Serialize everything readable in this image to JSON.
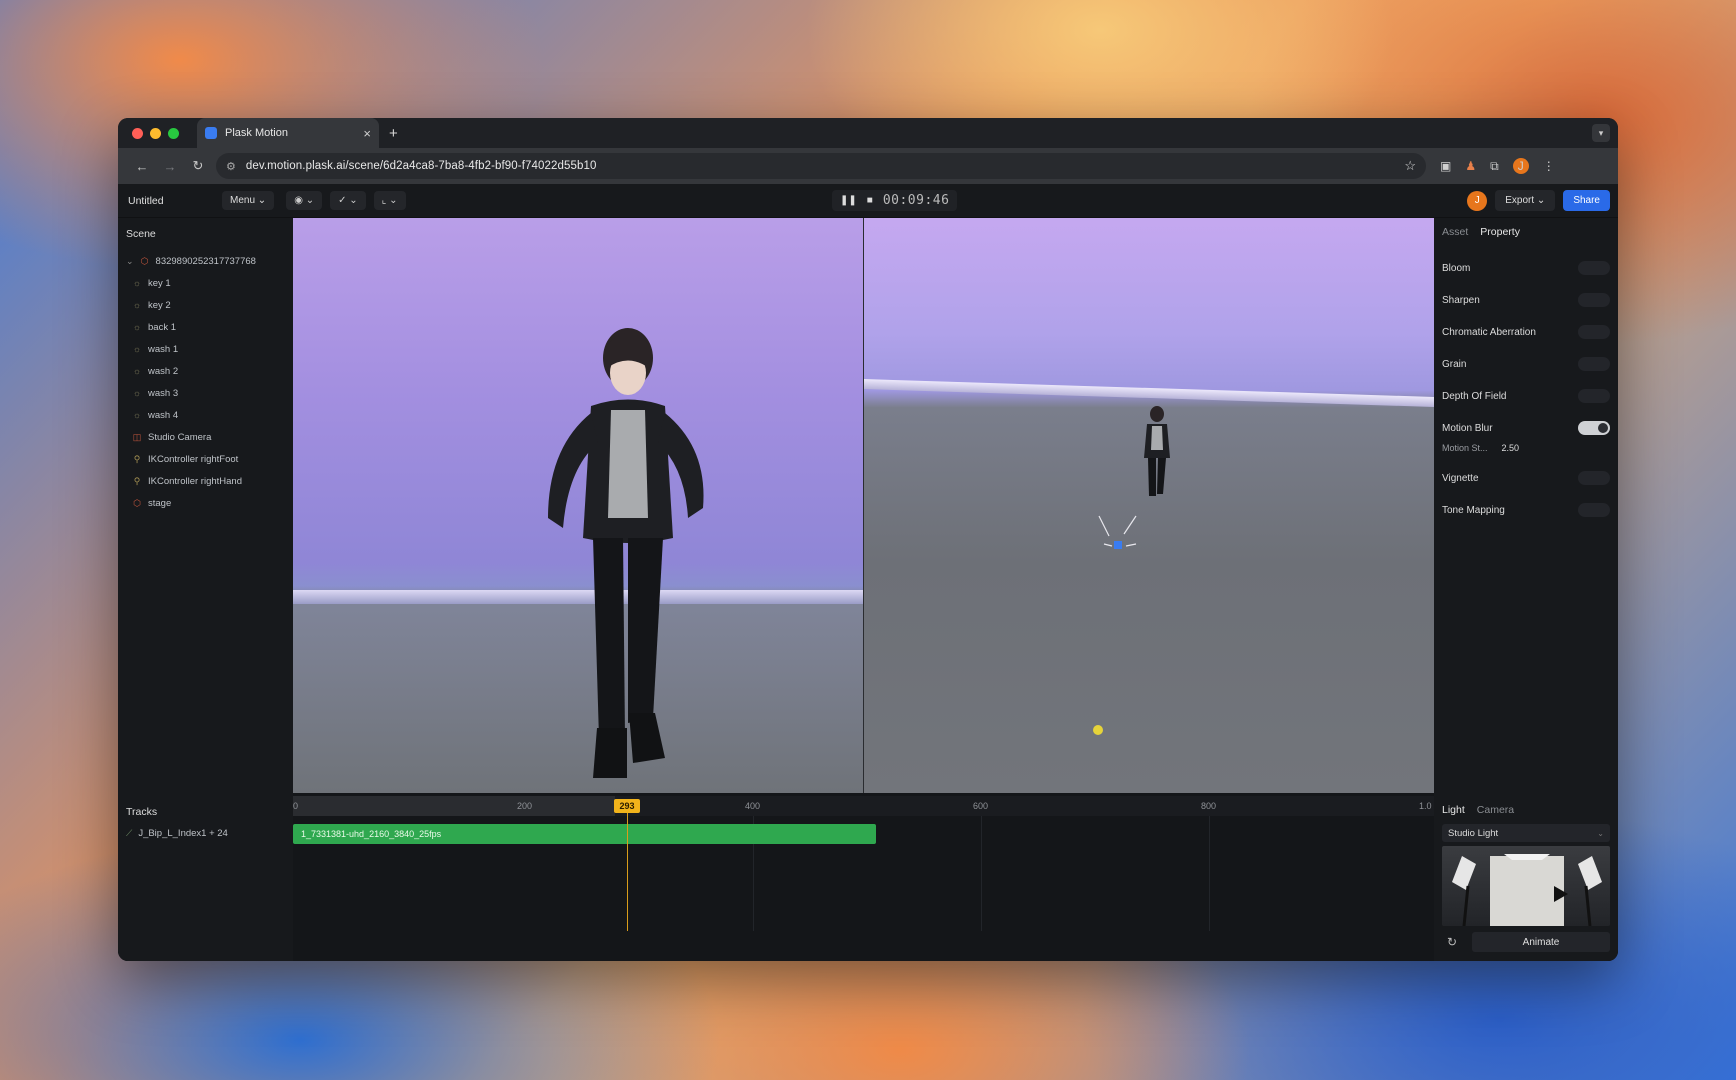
{
  "browser": {
    "tab_title": "Plask Motion",
    "tab_close": "×",
    "new_tab": "+",
    "url": "dev.motion.plask.ai/scene/6d2a4ca8-7ba8-4fb2-bf90-f74022d55b10",
    "profile_initial": "J"
  },
  "toolbar": {
    "project_name": "Untitled",
    "menu_label": "Menu",
    "time": "00:09:46",
    "export_label": "Export",
    "share_label": "Share",
    "avatar_initial": "J"
  },
  "scene": {
    "title": "Scene",
    "root": "8329890252317737768",
    "items": [
      {
        "label": "key 1",
        "icon": "light-icon"
      },
      {
        "label": "key 2",
        "icon": "light-icon"
      },
      {
        "label": "back 1",
        "icon": "light-icon"
      },
      {
        "label": "wash 1",
        "icon": "light-icon"
      },
      {
        "label": "wash 2",
        "icon": "light-icon"
      },
      {
        "label": "wash 3",
        "icon": "light-icon"
      },
      {
        "label": "wash 4",
        "icon": "light-icon"
      },
      {
        "label": "Studio Camera",
        "icon": "camera-icon"
      },
      {
        "label": "IKController rightFoot",
        "icon": "controller-icon"
      },
      {
        "label": "IKController rightHand",
        "icon": "controller-icon"
      },
      {
        "label": "stage",
        "icon": "mesh-icon"
      }
    ]
  },
  "properties": {
    "tabs": [
      "Asset",
      "Property"
    ],
    "active_tab": "Property",
    "items": [
      {
        "label": "Bloom",
        "on": false
      },
      {
        "label": "Sharpen",
        "on": false
      },
      {
        "label": "Chromatic Aberration",
        "on": false
      },
      {
        "label": "Grain",
        "on": false
      },
      {
        "label": "Depth Of Field",
        "on": false
      },
      {
        "label": "Motion Blur",
        "on": true
      },
      {
        "label": "Vignette",
        "on": false
      },
      {
        "label": "Tone Mapping",
        "on": false
      }
    ],
    "motion_strength_label": "Motion St...",
    "motion_strength_value": "2.50"
  },
  "timeline": {
    "tracks_title": "Tracks",
    "track_label": "J_Bip_L_Index1 + 24",
    "ruler_labels": [
      "0",
      "200",
      "400",
      "600",
      "800",
      "1.0"
    ],
    "playhead": "293",
    "clip_label": "1_7331381-uhd_2160_3840_25fps"
  },
  "light": {
    "tabs": [
      "Light",
      "Camera"
    ],
    "active_tab": "Light",
    "preset": "Studio Light",
    "animate_label": "Animate"
  },
  "colors": {
    "accent_blue": "#2a6ae8",
    "clip_green": "#2fa84f",
    "playhead_yellow": "#f1b31b",
    "avatar_orange": "#e7761c"
  }
}
